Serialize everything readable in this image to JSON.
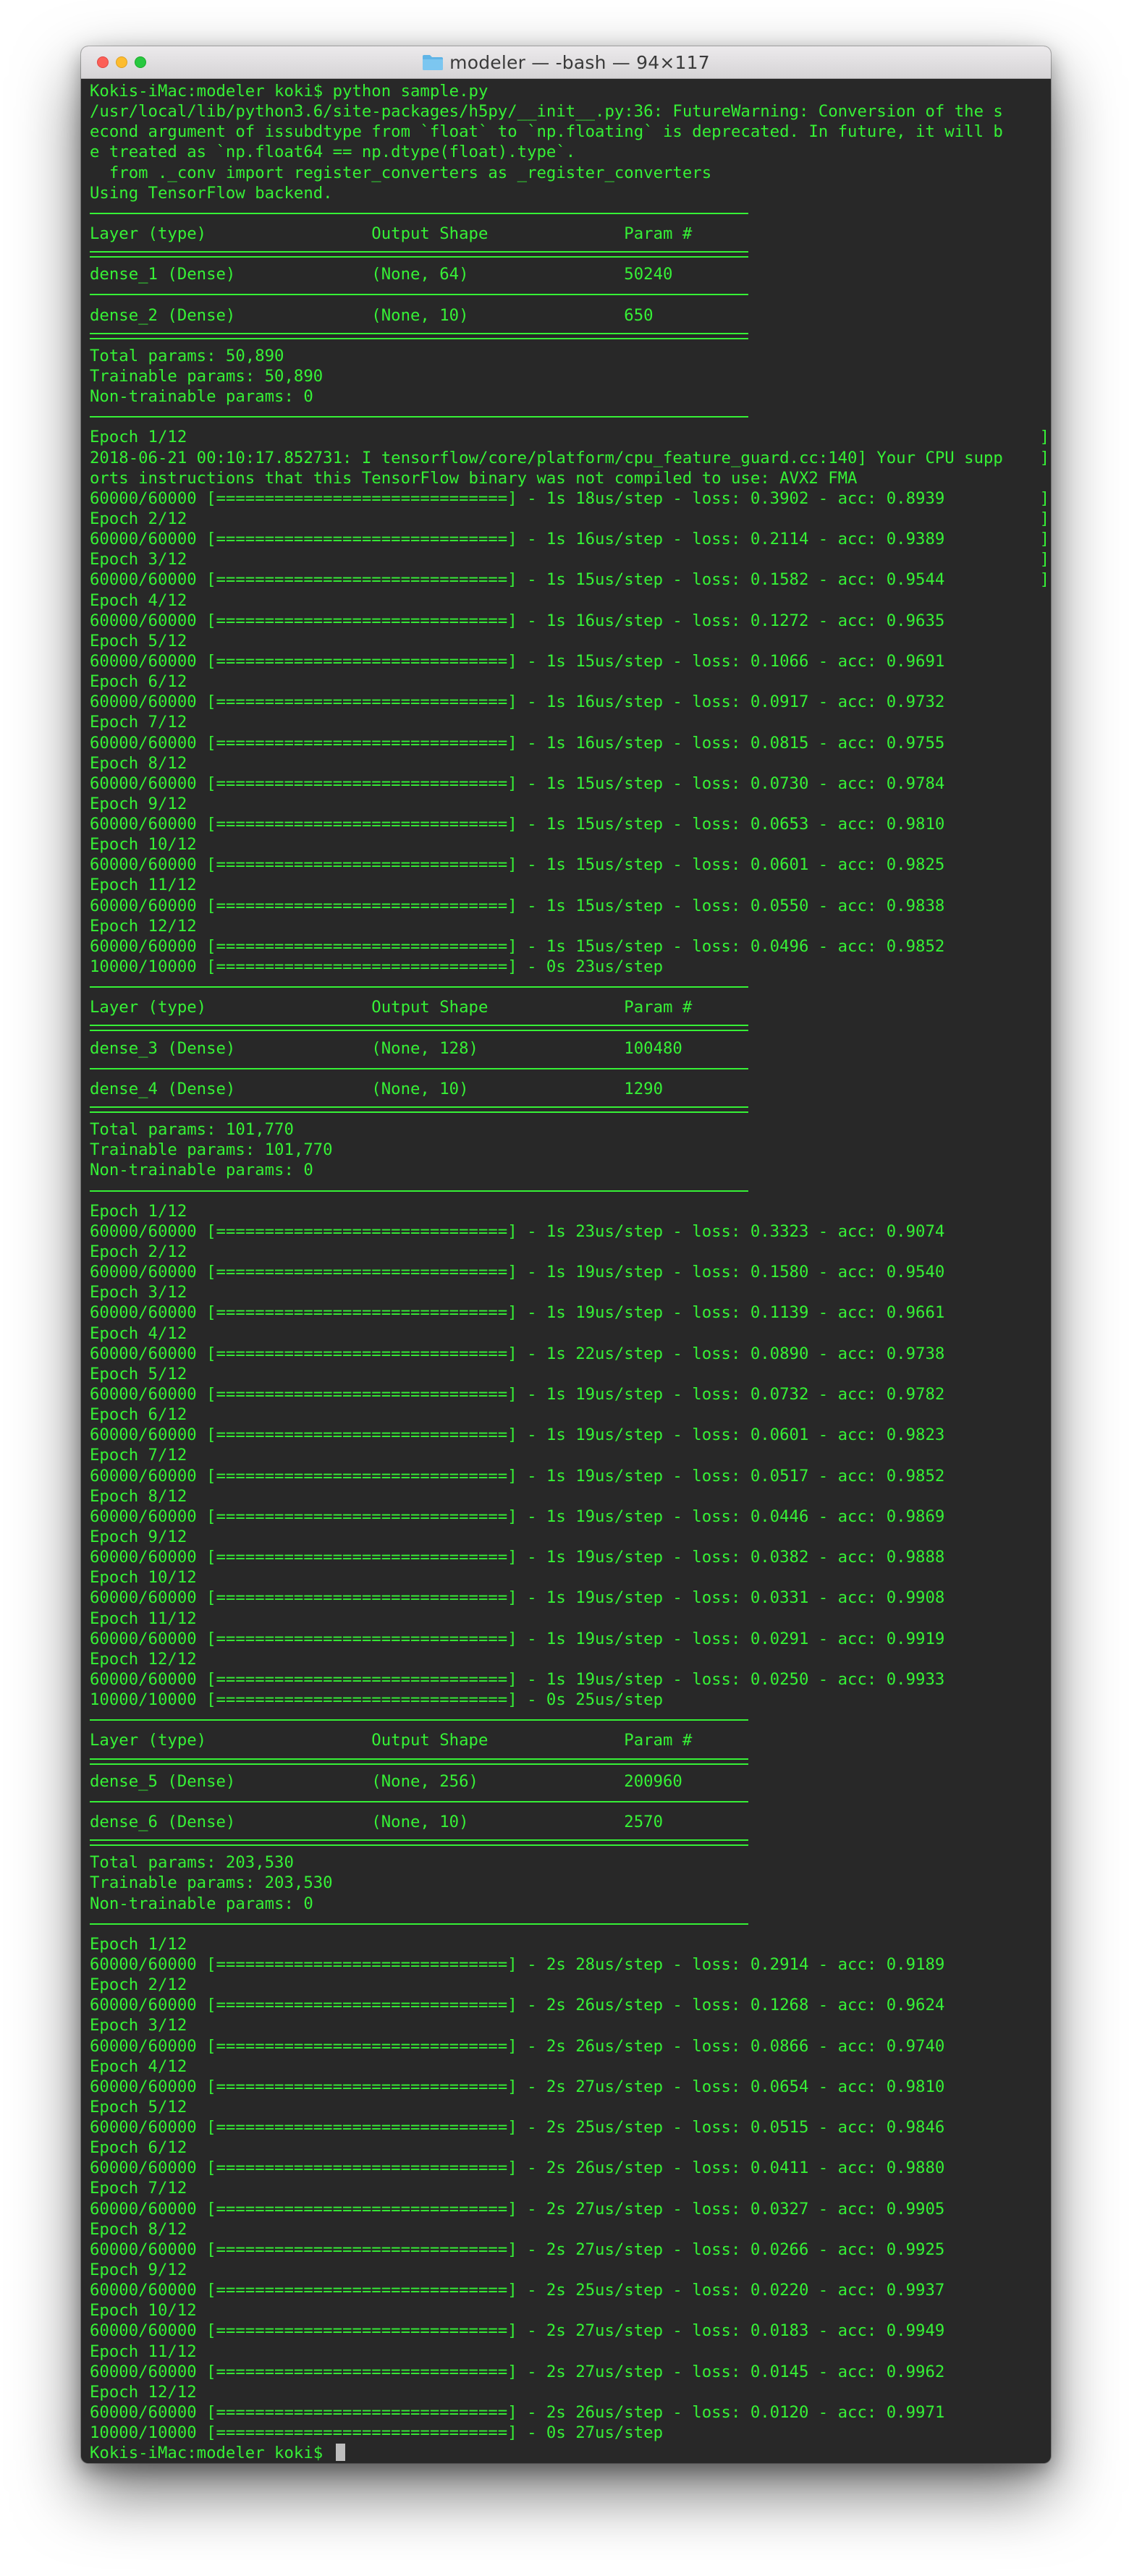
{
  "window": {
    "title": "modeler — -bash — 94×117",
    "folder_icon": "folder-icon",
    "colors": {
      "text": "#36f136",
      "background": "#282828"
    }
  },
  "terminal": {
    "prompt": "Kokis-iMac:modeler koki$ ",
    "lines": [
      "Kokis-iMac:modeler koki$ python sample.py",
      "/usr/local/lib/python3.6/site-packages/h5py/__init__.py:36: FutureWarning: Conversion of the s",
      "econd argument of issubdtype from `float` to `np.floating` is deprecated. In future, it will b",
      "e treated as `np.float64 == np.dtype(float).type`.",
      "  from ._conv import register_converters as _register_converters",
      "Using TensorFlow backend.",
      "__RULE__",
      "Layer (type)                 Output Shape              Param #",
      "__DRULE__",
      "dense_1 (Dense)              (None, 64)                50240",
      "__RULE__",
      "dense_2 (Dense)              (None, 10)                650",
      "__DRULE__",
      "Total params: 50,890",
      "Trainable params: 50,890",
      "Non-trainable params: 0",
      "__RULE__",
      "Epoch 1/12",
      "2018-06-21 00:10:17.852731: I tensorflow/core/platform/cpu_feature_guard.cc:140] Your CPU supp",
      "orts instructions that this TensorFlow binary was not compiled to use: AVX2 FMA",
      "60000/60000 [==============================] - 1s 18us/step - loss: 0.3902 - acc: 0.8939",
      "Epoch 2/12",
      "60000/60000 [==============================] - 1s 16us/step - loss: 0.2114 - acc: 0.9389",
      "Epoch 3/12",
      "60000/60000 [==============================] - 1s 15us/step - loss: 0.1582 - acc: 0.9544",
      "Epoch 4/12",
      "60000/60000 [==============================] - 1s 16us/step - loss: 0.1272 - acc: 0.9635",
      "Epoch 5/12",
      "60000/60000 [==============================] - 1s 15us/step - loss: 0.1066 - acc: 0.9691",
      "Epoch 6/12",
      "60000/60000 [==============================] - 1s 16us/step - loss: 0.0917 - acc: 0.9732",
      "Epoch 7/12",
      "60000/60000 [==============================] - 1s 16us/step - loss: 0.0815 - acc: 0.9755",
      "Epoch 8/12",
      "60000/60000 [==============================] - 1s 15us/step - loss: 0.0730 - acc: 0.9784",
      "Epoch 9/12",
      "60000/60000 [==============================] - 1s 15us/step - loss: 0.0653 - acc: 0.9810",
      "Epoch 10/12",
      "60000/60000 [==============================] - 1s 15us/step - loss: 0.0601 - acc: 0.9825",
      "Epoch 11/12",
      "60000/60000 [==============================] - 1s 15us/step - loss: 0.0550 - acc: 0.9838",
      "Epoch 12/12",
      "60000/60000 [==============================] - 1s 15us/step - loss: 0.0496 - acc: 0.9852",
      "10000/10000 [==============================] - 0s 23us/step",
      "__RULE__",
      "Layer (type)                 Output Shape              Param #",
      "__DRULE__",
      "dense_3 (Dense)              (None, 128)               100480",
      "__RULE__",
      "dense_4 (Dense)              (None, 10)                1290",
      "__DRULE__",
      "Total params: 101,770",
      "Trainable params: 101,770",
      "Non-trainable params: 0",
      "__RULE__",
      "Epoch 1/12",
      "60000/60000 [==============================] - 1s 23us/step - loss: 0.3323 - acc: 0.9074",
      "Epoch 2/12",
      "60000/60000 [==============================] - 1s 19us/step - loss: 0.1580 - acc: 0.9540",
      "Epoch 3/12",
      "60000/60000 [==============================] - 1s 19us/step - loss: 0.1139 - acc: 0.9661",
      "Epoch 4/12",
      "60000/60000 [==============================] - 1s 22us/step - loss: 0.0890 - acc: 0.9738",
      "Epoch 5/12",
      "60000/60000 [==============================] - 1s 19us/step - loss: 0.0732 - acc: 0.9782",
      "Epoch 6/12",
      "60000/60000 [==============================] - 1s 19us/step - loss: 0.0601 - acc: 0.9823",
      "Epoch 7/12",
      "60000/60000 [==============================] - 1s 19us/step - loss: 0.0517 - acc: 0.9852",
      "Epoch 8/12",
      "60000/60000 [==============================] - 1s 19us/step - loss: 0.0446 - acc: 0.9869",
      "Epoch 9/12",
      "60000/60000 [==============================] - 1s 19us/step - loss: 0.0382 - acc: 0.9888",
      "Epoch 10/12",
      "60000/60000 [==============================] - 1s 19us/step - loss: 0.0331 - acc: 0.9908",
      "Epoch 11/12",
      "60000/60000 [==============================] - 1s 19us/step - loss: 0.0291 - acc: 0.9919",
      "Epoch 12/12",
      "60000/60000 [==============================] - 1s 19us/step - loss: 0.0250 - acc: 0.9933",
      "10000/10000 [==============================] - 0s 25us/step",
      "__RULE__",
      "Layer (type)                 Output Shape              Param #",
      "__DRULE__",
      "dense_5 (Dense)              (None, 256)               200960",
      "__RULE__",
      "dense_6 (Dense)              (None, 10)                2570",
      "__DRULE__",
      "Total params: 203,530",
      "Trainable params: 203,530",
      "Non-trainable params: 0",
      "__RULE__",
      "Epoch 1/12",
      "60000/60000 [==============================] - 2s 28us/step - loss: 0.2914 - acc: 0.9189",
      "Epoch 2/12",
      "60000/60000 [==============================] - 2s 26us/step - loss: 0.1268 - acc: 0.9624",
      "Epoch 3/12",
      "60000/60000 [==============================] - 2s 26us/step - loss: 0.0866 - acc: 0.9740",
      "Epoch 4/12",
      "60000/60000 [==============================] - 2s 27us/step - loss: 0.0654 - acc: 0.9810",
      "Epoch 5/12",
      "60000/60000 [==============================] - 2s 25us/step - loss: 0.0515 - acc: 0.9846",
      "Epoch 6/12",
      "60000/60000 [==============================] - 2s 26us/step - loss: 0.0411 - acc: 0.9880",
      "Epoch 7/12",
      "60000/60000 [==============================] - 2s 27us/step - loss: 0.0327 - acc: 0.9905",
      "Epoch 8/12",
      "60000/60000 [==============================] - 2s 27us/step - loss: 0.0266 - acc: 0.9925",
      "Epoch 9/12",
      "60000/60000 [==============================] - 2s 25us/step - loss: 0.0220 - acc: 0.9937",
      "Epoch 10/12",
      "60000/60000 [==============================] - 2s 27us/step - loss: 0.0183 - acc: 0.9949",
      "Epoch 11/12",
      "60000/60000 [==============================] - 2s 27us/step - loss: 0.0145 - acc: 0.9962",
      "Epoch 12/12",
      "60000/60000 [==============================] - 2s 26us/step - loss: 0.0120 - acc: 0.9971",
      "10000/10000 [==============================] - 0s 27us/step"
    ]
  }
}
